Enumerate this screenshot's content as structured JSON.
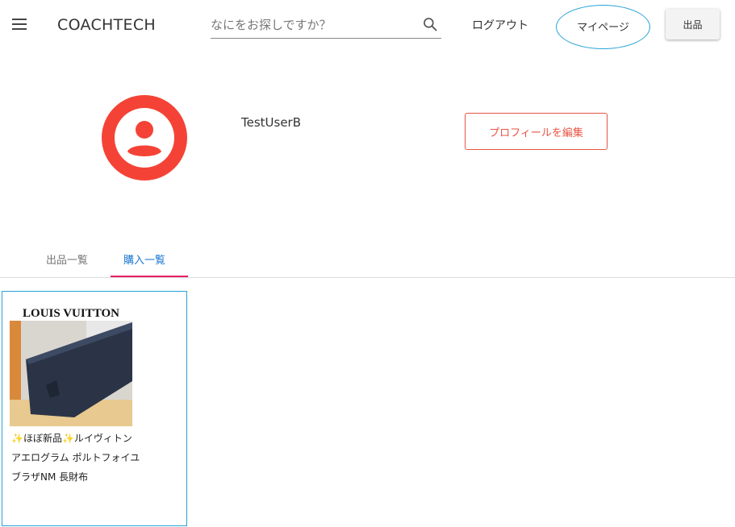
{
  "header": {
    "menu_icon": "hamburger-menu-icon",
    "brand": "COACHTECH",
    "search": {
      "placeholder": "なにをお探しですか？",
      "value": "",
      "icon": "search-icon"
    },
    "logout_label": "ログアウト",
    "mypage_label": "マイページ",
    "sell_label": "出品"
  },
  "profile": {
    "avatar_icon": "account-circle-icon",
    "avatar_color": "#f44336",
    "username": "TestUserB",
    "edit_label": "プロフィールを編集"
  },
  "tabs": {
    "items": [
      {
        "label": "出品一覧",
        "active": false
      },
      {
        "label": "購入一覧",
        "active": true
      }
    ],
    "active_color": "#1976d2",
    "indicator_color": "#e91e63"
  },
  "items": [
    {
      "image_text": "LOUIS VUITTON",
      "title": "✨ほぼ新品✨ルイヴィトン アエログラム ポルトフォイユ ブラザNM 長財布"
    }
  ],
  "highlight_color": "#29a3d6"
}
